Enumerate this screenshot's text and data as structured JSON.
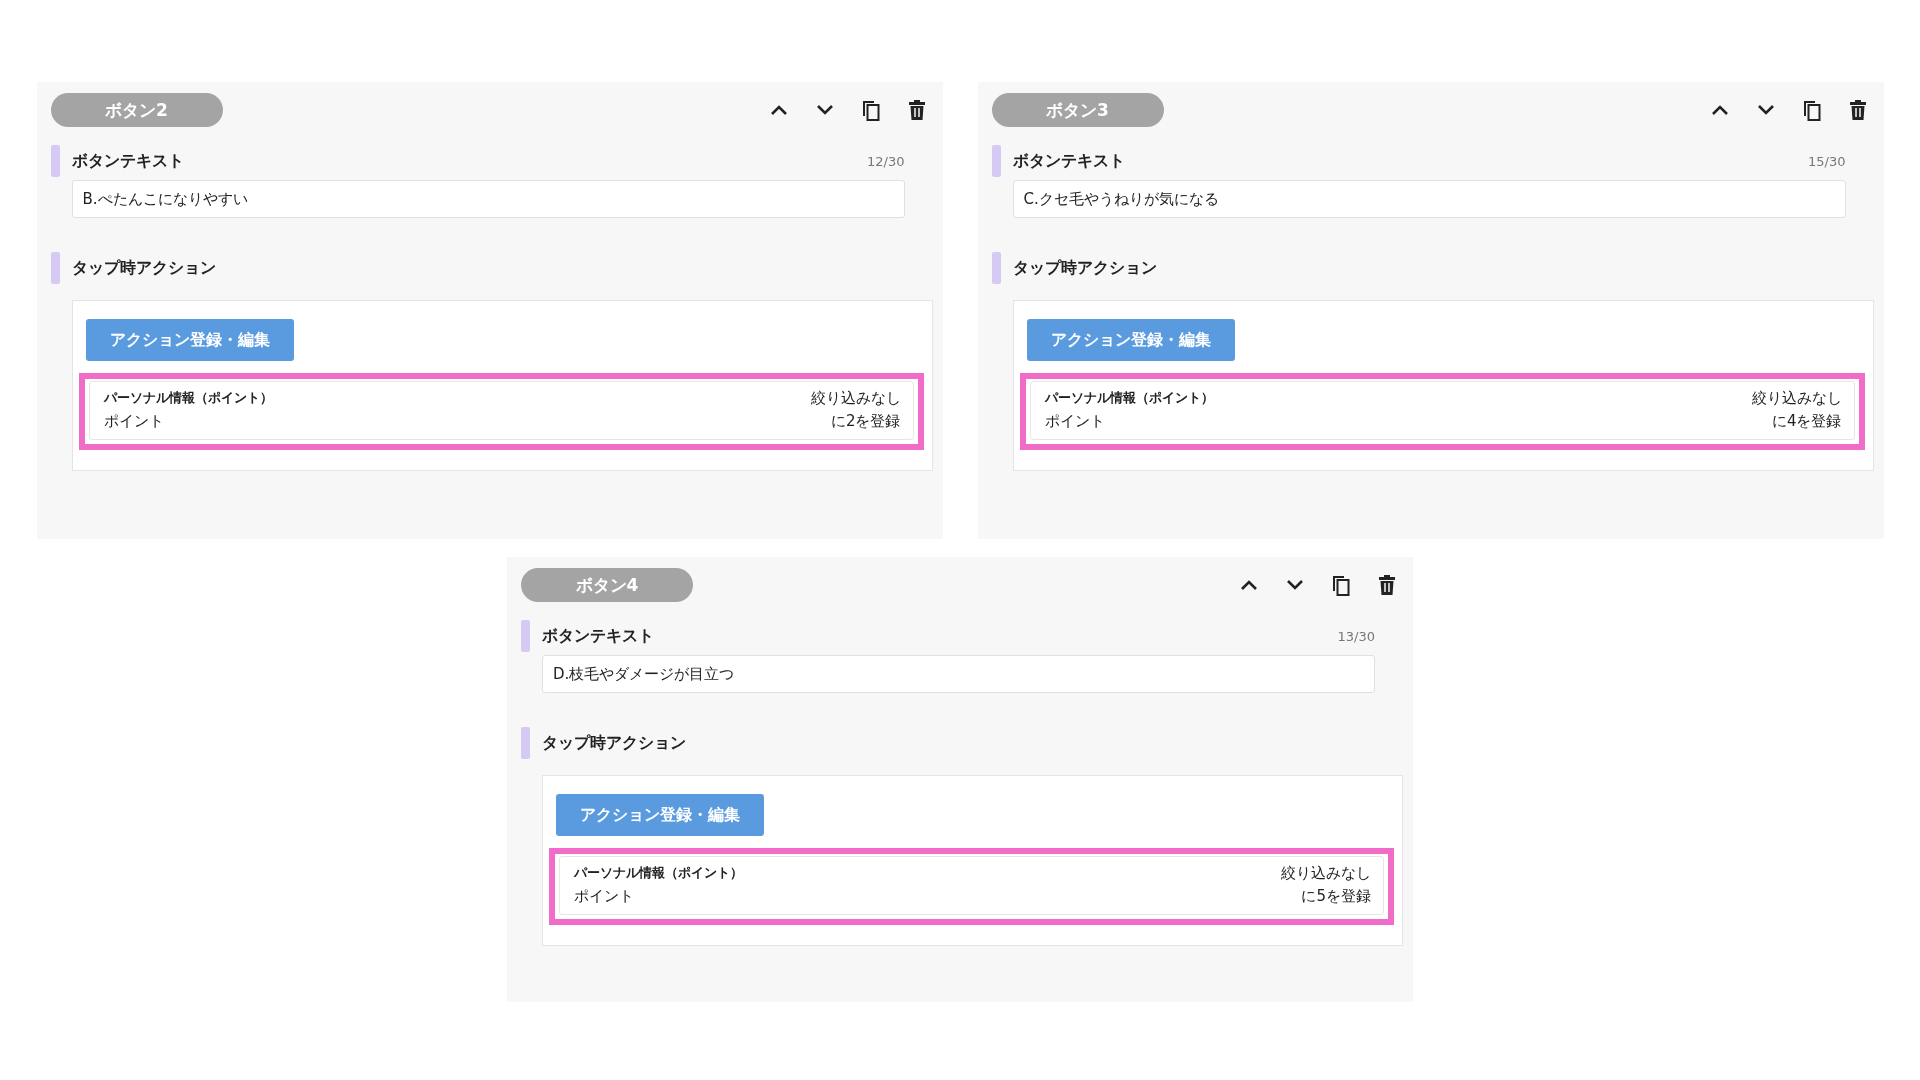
{
  "panels": [
    {
      "title": "ボタン2",
      "text_label": "ボタンテキスト",
      "counter": "12/30",
      "value": "B.ぺたんこになりやすい",
      "action_label": "タップ時アクション",
      "action_button": "アクション登録・編集",
      "action": {
        "title": "パーソナル情報（ポイント）",
        "subtitle": "ポイント",
        "filter": "絞り込みなし",
        "result": "に2を登録"
      }
    },
    {
      "title": "ボタン3",
      "text_label": "ボタンテキスト",
      "counter": "15/30",
      "value": "C.クセ毛やうねりが気になる",
      "action_label": "タップ時アクション",
      "action_button": "アクション登録・編集",
      "action": {
        "title": "パーソナル情報（ポイント）",
        "subtitle": "ポイント",
        "filter": "絞り込みなし",
        "result": "に4を登録"
      }
    },
    {
      "title": "ボタン4",
      "text_label": "ボタンテキスト",
      "counter": "13/30",
      "value": "D.枝毛やダメージが目立つ",
      "action_label": "タップ時アクション",
      "action_button": "アクション登録・編集",
      "action": {
        "title": "パーソナル情報（ポイント）",
        "subtitle": "ポイント",
        "filter": "絞り込みなし",
        "result": "に5を登録"
      }
    }
  ]
}
